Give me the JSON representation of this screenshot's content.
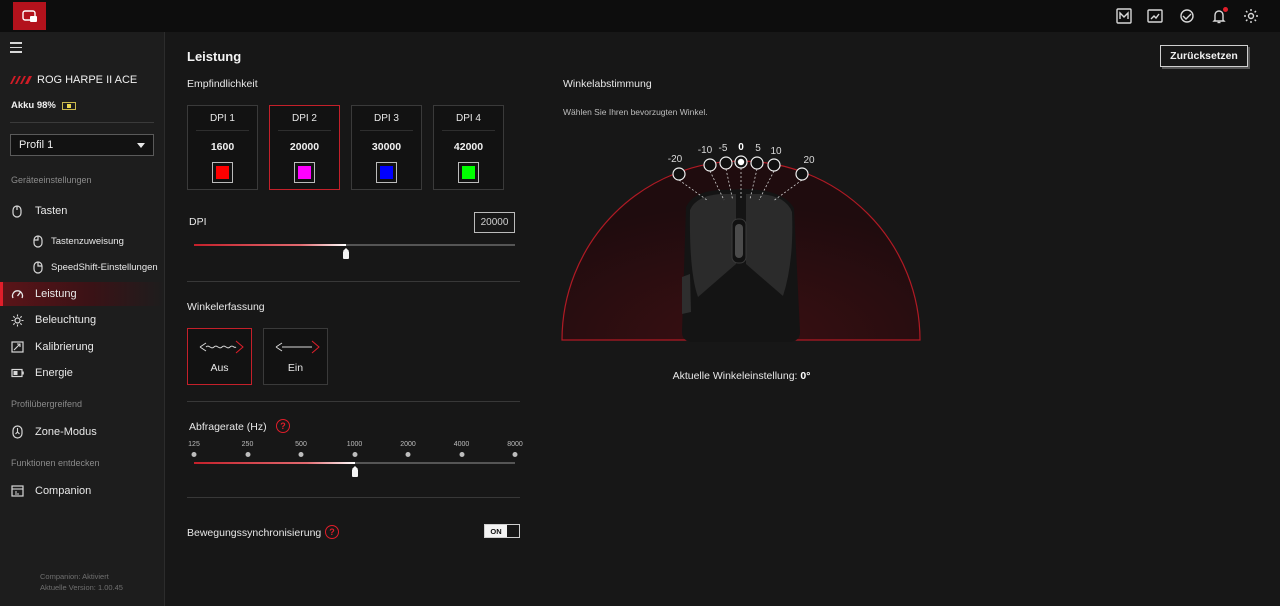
{
  "colors": {
    "accent": "#e01e2a",
    "background": "#171717",
    "sidebar": "#1d1d1d"
  },
  "topbar": {
    "icons": [
      "app-logo-icon",
      "macro-icon",
      "display-icon",
      "sync-icon",
      "bell-icon",
      "gear-icon"
    ]
  },
  "device": {
    "name": "ROG HARPE II ACE",
    "battery": "Akku 98%"
  },
  "profile": {
    "selected": "Profil 1"
  },
  "sidebar": {
    "sections": {
      "device_settings": "Geräteeinstellungen",
      "cross_profile": "Profilübergreifend",
      "discover": "Funktionen entdecken"
    },
    "items": [
      {
        "label": "Tasten",
        "icon": "mouse-icon"
      },
      {
        "label": "Tastenzuweisung",
        "icon": "mouse-button-icon"
      },
      {
        "label": "SpeedShift-Einstellungen",
        "icon": "mouse-button-icon"
      },
      {
        "label": "Leistung",
        "icon": "gauge-icon"
      },
      {
        "label": "Beleuchtung",
        "icon": "sun-icon"
      },
      {
        "label": "Kalibrierung",
        "icon": "calibration-icon"
      },
      {
        "label": "Energie",
        "icon": "battery-icon"
      },
      {
        "label": "Zone-Modus",
        "icon": "zone-icon"
      },
      {
        "label": "Companion",
        "icon": "companion-icon"
      }
    ],
    "footer": {
      "status": "Companion:  Aktiviert",
      "version": "Aktuelle Version: 1.00.45"
    }
  },
  "main": {
    "title": "Leistung",
    "reset_label": "Zurücksetzen",
    "sensitivity": {
      "title": "Empfindlichkeit",
      "stages": [
        {
          "label": "DPI 1",
          "value": "1600",
          "color": "#ff0000"
        },
        {
          "label": "DPI 2",
          "value": "20000",
          "color": "#ff00ff"
        },
        {
          "label": "DPI 3",
          "value": "30000",
          "color": "#0000ff"
        },
        {
          "label": "DPI 4",
          "value": "42000",
          "color": "#00ff00"
        }
      ],
      "selected_stage": 2
    },
    "dpi": {
      "label": "DPI",
      "value": "20000",
      "fraction": 0.475
    },
    "angle_snapping": {
      "title": "Winkelerfassung",
      "options": [
        "Aus",
        "Ein"
      ],
      "selected": "Aus"
    },
    "polling": {
      "title": "Abfragerate (Hz)",
      "help": "?",
      "rates": [
        "125",
        "250",
        "500",
        "1000",
        "2000",
        "4000",
        "8000"
      ],
      "selected_index": 3
    },
    "motion_sync": {
      "title": "Bewegungssynchronisierung",
      "help": "?",
      "state": "ON"
    },
    "angle_tuning": {
      "title": "Winkelabstimmung",
      "subtitle": "Wählen Sie Ihren bevorzugten Winkel.",
      "angles": [
        "-20",
        "-10",
        "-5",
        "0",
        "5",
        "10",
        "20"
      ],
      "selected": "0",
      "current_label": "Aktuelle Winkeleinstellung:",
      "current_value": "0°"
    }
  }
}
